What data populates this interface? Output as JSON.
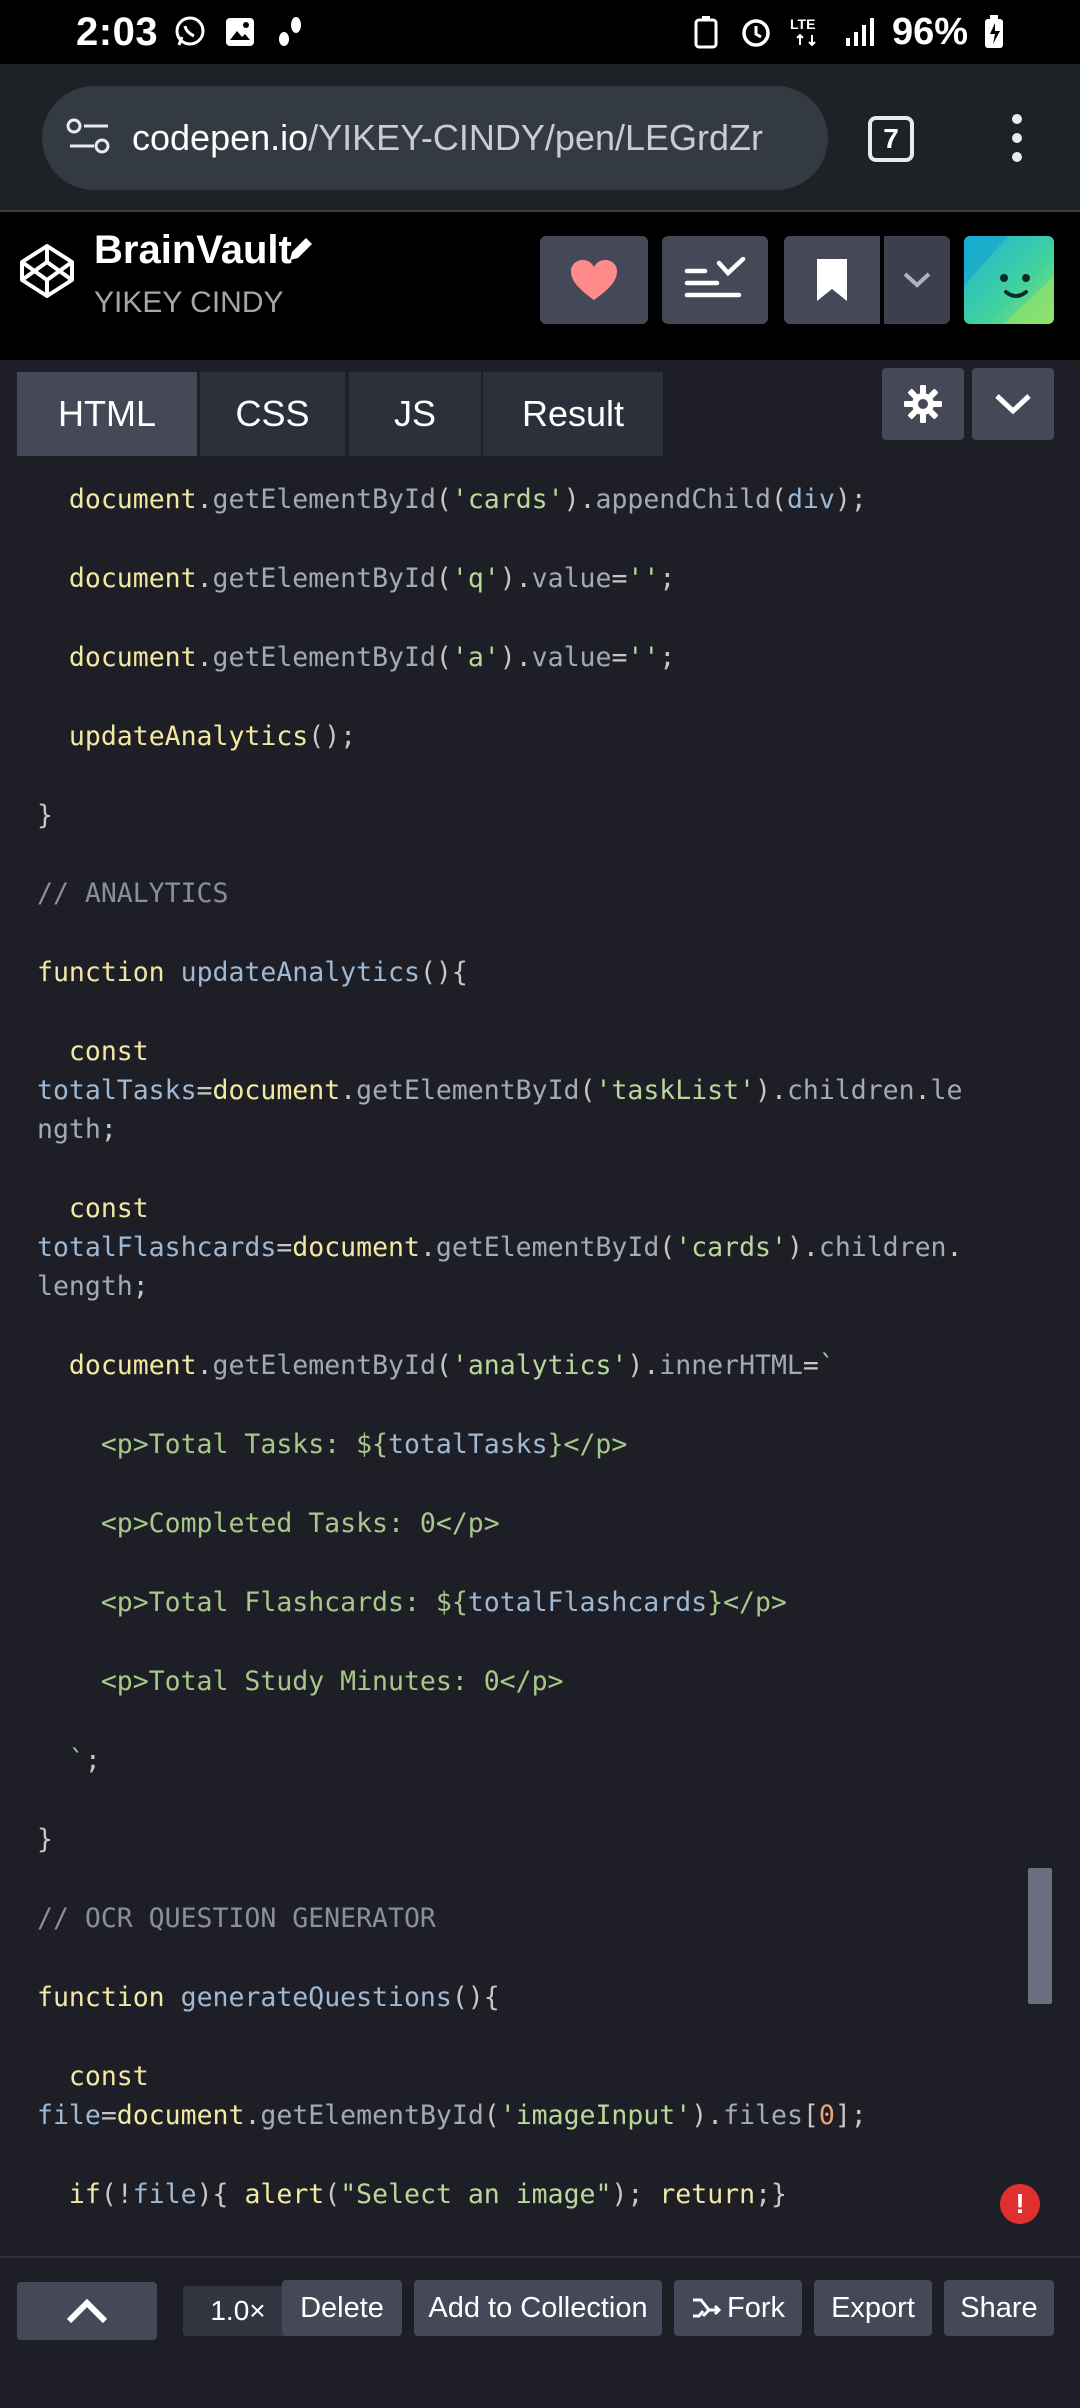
{
  "status_bar": {
    "time": "2:03",
    "battery": "96%",
    "network": "LTE"
  },
  "browser": {
    "url_host": "codepen.io",
    "url_path": "/YIKEY-CINDY/pen/LEGrdZr",
    "tab_count": "7"
  },
  "pen": {
    "title": "BrainVault",
    "author": "YIKEY CINDY"
  },
  "tabs": [
    {
      "label": "HTML"
    },
    {
      "label": "CSS"
    },
    {
      "label": "JS"
    },
    {
      "label": "Result"
    }
  ],
  "bottom_bar": {
    "zoom": "1.0×",
    "delete": "Delete",
    "add_to_collection": "Add to Collection",
    "fork": "Fork",
    "export": "Export",
    "share": "Share"
  },
  "error_badge": "!",
  "colors": {
    "editor_bg": "#1e1f26",
    "tab_active": "#444857",
    "heart": "#ff8a8a",
    "error": "#e0312f"
  }
}
